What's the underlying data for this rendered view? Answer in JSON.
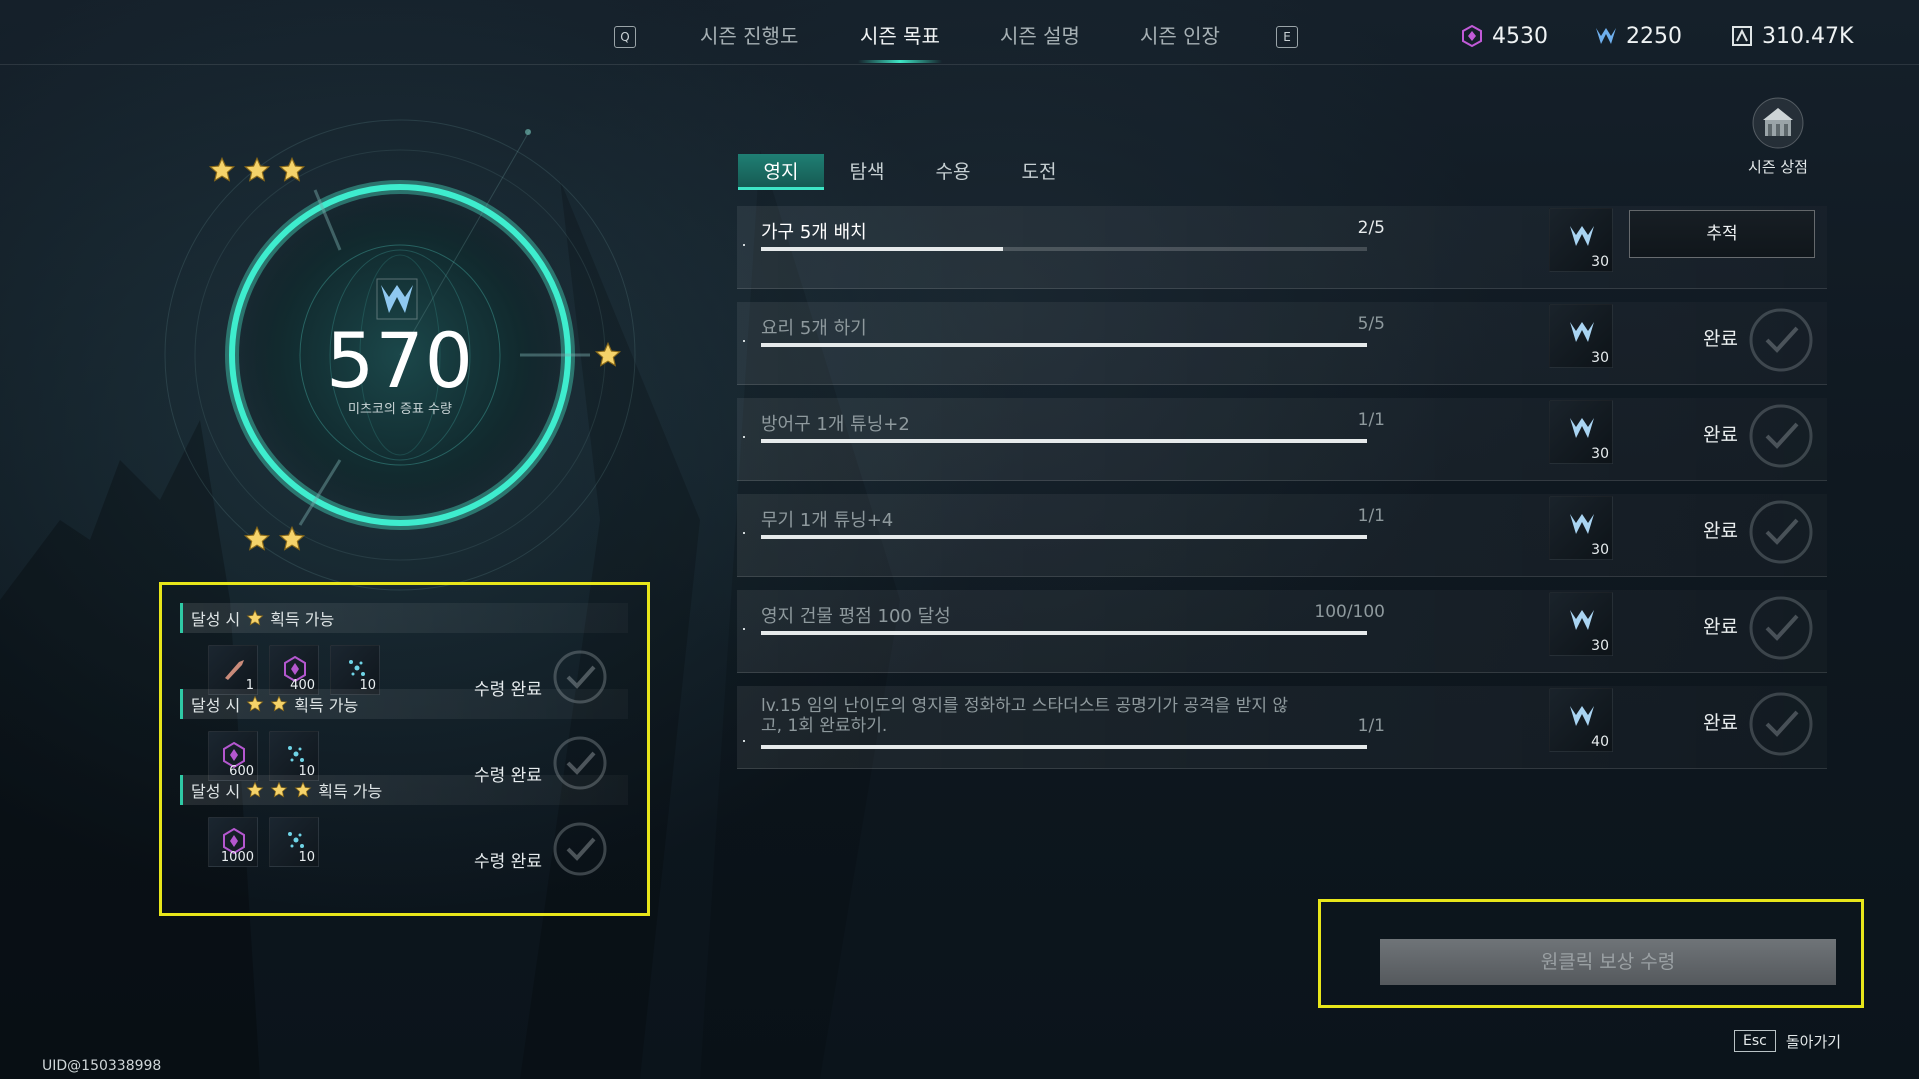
{
  "nav": {
    "key_left": "Q",
    "key_right": "E",
    "tabs": [
      "시즌 진행도",
      "시즌 목표",
      "시즌 설명",
      "시즌 인장"
    ],
    "active_tab": "시즌 목표"
  },
  "currencies": [
    {
      "icon": "crystal-icon",
      "value": "4530",
      "color": "#c15ad8"
    },
    {
      "icon": "season-emblem-icon",
      "value": "2250",
      "color": "#6fb0ee"
    },
    {
      "icon": "token-icon",
      "value": "310.47K",
      "color": "#dfe5e6"
    }
  ],
  "shop": {
    "label": "시즌 상점",
    "icon": "shop-building-icon"
  },
  "score": {
    "value": "570",
    "label": "미츠코의 증표 수량"
  },
  "rewards": {
    "prefix": "달성 시",
    "suffix": "획득 가능",
    "claimed_label": "수령 완료",
    "tiers": [
      {
        "stars": 1,
        "items": [
          {
            "icon": "bullet-icon",
            "qty": "1"
          },
          {
            "icon": "crystal-icon",
            "qty": "400"
          },
          {
            "icon": "sparkle-icon",
            "qty": "10"
          }
        ]
      },
      {
        "stars": 2,
        "items": [
          {
            "icon": "crystal-icon",
            "qty": "600"
          },
          {
            "icon": "sparkle-icon",
            "qty": "10"
          }
        ]
      },
      {
        "stars": 3,
        "items": [
          {
            "icon": "crystal-icon",
            "qty": "1000"
          },
          {
            "icon": "sparkle-icon",
            "qty": "10"
          }
        ]
      }
    ]
  },
  "subtabs": [
    "영지",
    "탐색",
    "수용",
    "도전"
  ],
  "missions": [
    {
      "title": "가구 5개 배치",
      "count": "2/5",
      "progress": 0.4,
      "reward_qty": "30",
      "status": "active",
      "action": "추적"
    },
    {
      "title": "요리 5개 하기",
      "count": "5/5",
      "progress": 1.0,
      "reward_qty": "30",
      "status": "done",
      "action": "완료"
    },
    {
      "title": "방어구 1개 튜닝+2",
      "count": "1/1",
      "progress": 1.0,
      "reward_qty": "30",
      "status": "done",
      "action": "완료"
    },
    {
      "title": "무기 1개 튜닝+4",
      "count": "1/1",
      "progress": 1.0,
      "reward_qty": "30",
      "status": "done",
      "action": "완료"
    },
    {
      "title": "영지 건물 평점 100 달성",
      "count": "100/100",
      "progress": 1.0,
      "reward_qty": "30",
      "status": "done",
      "action": "완료"
    },
    {
      "title": "lv.15 임의 난이도의 영지를 정화하고 스타더스트 공명기가 공격을 받지 않",
      "title_line2": "고, 1회 완료하기.",
      "count": "1/1",
      "progress": 1.0,
      "reward_qty": "40",
      "status": "done",
      "action": "완료"
    }
  ],
  "claim_all": "원클릭 보상 수령",
  "footer": {
    "esc_key": "Esc",
    "back_label": "돌아가기",
    "uid": "UID@150338998"
  }
}
